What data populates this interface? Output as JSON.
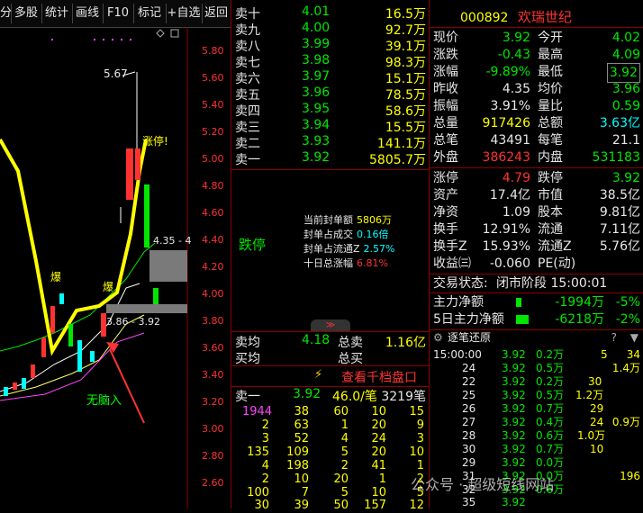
{
  "toolbar": {
    "items": [
      "分",
      "多股",
      "统计",
      "画线",
      "F10",
      "标记",
      "+自选",
      "返回"
    ]
  },
  "chart": {
    "price_axis": [
      "5.80",
      "5.60",
      "5.40",
      "5.20",
      "5.00",
      "4.80",
      "4.60",
      "4.40",
      "4.20",
      "4.00",
      "3.80",
      "3.60",
      "3.40",
      "3.20",
      "3.00",
      "2.80",
      "2.60"
    ],
    "labels": {
      "high_mark": "5.67",
      "limit_label": "涨停!",
      "range_a": "4.35 - 4",
      "range_b": "3.86 - 3.92",
      "explode_a": "爆",
      "explode_b": "爆",
      "annotation": "无脑入"
    }
  },
  "orderbook": {
    "sells": [
      {
        "label": "卖十",
        "price": "4.01",
        "vol": "16.5万"
      },
      {
        "label": "卖九",
        "price": "4.00",
        "vol": "92.7万"
      },
      {
        "label": "卖八",
        "price": "3.99",
        "vol": "39.1万"
      },
      {
        "label": "卖七",
        "price": "3.98",
        "vol": "98.3万"
      },
      {
        "label": "卖六",
        "price": "3.97",
        "vol": "15.1万"
      },
      {
        "label": "卖五",
        "price": "3.96",
        "vol": "78.5万"
      },
      {
        "label": "卖四",
        "price": "3.95",
        "vol": "58.6万"
      },
      {
        "label": "卖三",
        "price": "3.94",
        "vol": "15.5万"
      },
      {
        "label": "卖二",
        "price": "3.93",
        "vol": "141.1万"
      },
      {
        "label": "卖一",
        "price": "3.92",
        "vol": "5805.7万"
      }
    ],
    "status": "跌停",
    "fengdan": [
      {
        "label": "当前封单额",
        "value": "5806万",
        "color": "#ffff00"
      },
      {
        "label": "封单占成交",
        "value": "0.16倍",
        "color": "#00ffff"
      },
      {
        "label": "封单占流通Z",
        "value": "2.57%",
        "color": "#00ffff"
      },
      {
        "label": "十日总涨幅",
        "value": "6.81%",
        "color": "#ff3232"
      }
    ],
    "avg": {
      "label1": "卖均",
      "v1": "4.18",
      "label2": "总卖",
      "v2": "1.16亿",
      "label3": "买均",
      "label4": "总买"
    },
    "ten_button": "查看千档盘口",
    "sell1": {
      "label": "卖一",
      "price": "3.92",
      "vol": "46.0/笔",
      "count": "3219笔"
    },
    "trade_rows": [
      [
        "1944",
        "38",
        "60",
        "10",
        "15"
      ],
      [
        "2",
        "63",
        "1",
        "20",
        "9"
      ],
      [
        "3",
        "52",
        "4",
        "24",
        "3"
      ],
      [
        "135",
        "109",
        "5",
        "20",
        "10"
      ],
      [
        "4",
        "198",
        "2",
        "41",
        "1"
      ],
      [
        "2",
        "10",
        "20",
        "1",
        "2"
      ],
      [
        "100",
        "7",
        "5",
        "10",
        "5"
      ],
      [
        "30",
        "39",
        "50",
        "157",
        "12"
      ]
    ]
  },
  "quote": {
    "code": "000892",
    "name": "欢瑞世纪",
    "rows": [
      {
        "l1": "现价",
        "v1": "3.92",
        "c1": "#00e600",
        "l2": "今开",
        "v2": "4.02",
        "c2": "#00e600"
      },
      {
        "l1": "涨跌",
        "v1": "-0.43",
        "c1": "#00e600",
        "l2": "最高",
        "v2": "4.09",
        "c2": "#00e600"
      },
      {
        "l1": "涨幅",
        "v1": "-9.89%",
        "c1": "#00e600",
        "l2": "最低",
        "v2": "3.92",
        "c2": "#00e600"
      },
      {
        "l1": "昨收",
        "v1": "4.35",
        "c1": "#e8e8e8",
        "l2": "均价",
        "v2": "3.96",
        "c2": "#00e600"
      },
      {
        "l1": "振幅",
        "v1": "3.91%",
        "c1": "#e8e8e8",
        "l2": "量比",
        "v2": "0.59",
        "c2": "#00e600"
      },
      {
        "l1": "总量",
        "v1": "917426",
        "c1": "#ffff00",
        "l2": "总额",
        "v2": "3.63亿",
        "c2": "#00ffff"
      },
      {
        "l1": "总笔",
        "v1": "43491",
        "c1": "#e8e8e8",
        "l2": "每笔",
        "v2": "21.1",
        "c2": "#e8e8e8"
      },
      {
        "l1": "外盘",
        "v1": "386243",
        "c1": "#ff3232",
        "l2": "内盘",
        "v2": "531183",
        "c2": "#00e600"
      }
    ],
    "rows2": [
      {
        "l1": "涨停",
        "v1": "4.79",
        "c1": "#ff3232",
        "l2": "跌停",
        "v2": "3.92",
        "c2": "#00e600"
      },
      {
        "l1": "资产",
        "v1": "17.4亿",
        "c1": "#e8e8e8",
        "l2": "市值",
        "v2": "38.5亿",
        "c2": "#e8e8e8"
      },
      {
        "l1": "净资",
        "v1": "1.09",
        "c1": "#e8e8e8",
        "l2": "股本",
        "v2": "9.81亿",
        "c2": "#e8e8e8"
      },
      {
        "l1": "换手",
        "v1": "12.91%",
        "c1": "#e8e8e8",
        "l2": "流通",
        "v2": "7.11亿",
        "c2": "#e8e8e8"
      },
      {
        "l1": "换手Z",
        "v1": "15.93%",
        "c1": "#e8e8e8",
        "l2": "流通Z",
        "v2": "5.76亿",
        "c2": "#e8e8e8"
      },
      {
        "l1": "收益㈢",
        "v1": "-0.060",
        "c1": "#e8e8e8",
        "l2": "PE(动)",
        "v2": "",
        "c2": "#e8e8e8"
      }
    ],
    "trade_status": {
      "label": "交易状态:",
      "value": "闭市阶段 15:00:01"
    },
    "flow": [
      {
        "label": "主力净额",
        "value": "-1994万",
        "pct": "-5%",
        "bar": 0.15
      },
      {
        "label": "5日主力净额",
        "value": "-6218万",
        "pct": "-2%",
        "bar": 0.35
      }
    ],
    "tick_title": "逐笔还原",
    "ticks": [
      {
        "t": "15:00:00",
        "p": "3.92",
        "v": "0.2万",
        "a": "5",
        "b": "34"
      },
      {
        "t": "24",
        "p": "3.92",
        "v": "0.5万",
        "a": "",
        "b": "1.4万"
      },
      {
        "t": "22",
        "p": "3.92",
        "v": "0.2万",
        "a": "30",
        "b": ""
      },
      {
        "t": "25",
        "p": "3.92",
        "v": "0.5万",
        "a": "",
        "b": "1.2万"
      },
      {
        "t": "26",
        "p": "3.92",
        "v": "0.7万",
        "a": "",
        "b": "29"
      },
      {
        "t": "27",
        "p": "3.92",
        "v": "0.4万",
        "a": "24",
        "b": "0.9万"
      },
      {
        "t": "28",
        "p": "3.92",
        "v": "0.6万",
        "a": "",
        "b": "1.0万"
      },
      {
        "t": "30",
        "p": "3.92",
        "v": "0.7万",
        "a": "10",
        "b": ""
      },
      {
        "t": "29",
        "p": "3.92",
        "v": "0.0万",
        "a": "",
        "b": ""
      },
      {
        "t": "31",
        "p": "3.92",
        "v": "0.0万",
        "a": "",
        "b": "196"
      },
      {
        "t": "32",
        "p": "3.92",
        "v": "0.6万",
        "a": "",
        "b": ""
      },
      {
        "t": "35",
        "p": "3.92",
        "v": "",
        "a": "",
        "b": ""
      }
    ]
  },
  "watermark": "公众号 · 超级短线网站"
}
